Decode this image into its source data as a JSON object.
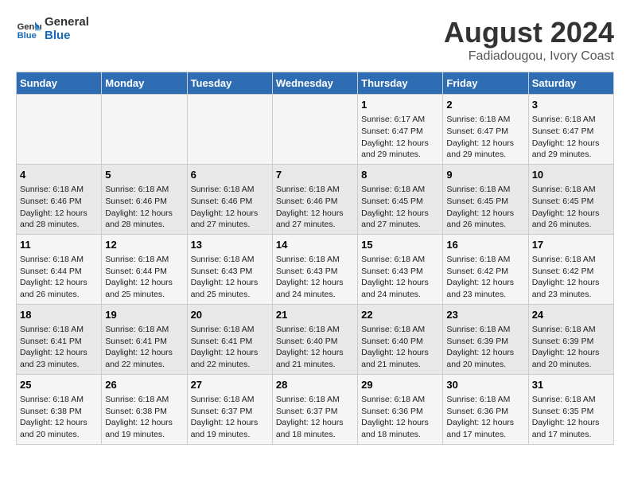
{
  "header": {
    "logo_line1": "General",
    "logo_line2": "Blue",
    "main_title": "August 2024",
    "subtitle": "Fadiadougou, Ivory Coast"
  },
  "days_of_week": [
    "Sunday",
    "Monday",
    "Tuesday",
    "Wednesday",
    "Thursday",
    "Friday",
    "Saturday"
  ],
  "weeks": [
    [
      {
        "day": "",
        "info": ""
      },
      {
        "day": "",
        "info": ""
      },
      {
        "day": "",
        "info": ""
      },
      {
        "day": "",
        "info": ""
      },
      {
        "day": "1",
        "info": "Sunrise: 6:17 AM\nSunset: 6:47 PM\nDaylight: 12 hours and 29 minutes."
      },
      {
        "day": "2",
        "info": "Sunrise: 6:18 AM\nSunset: 6:47 PM\nDaylight: 12 hours and 29 minutes."
      },
      {
        "day": "3",
        "info": "Sunrise: 6:18 AM\nSunset: 6:47 PM\nDaylight: 12 hours and 29 minutes."
      }
    ],
    [
      {
        "day": "4",
        "info": "Sunrise: 6:18 AM\nSunset: 6:46 PM\nDaylight: 12 hours and 28 minutes."
      },
      {
        "day": "5",
        "info": "Sunrise: 6:18 AM\nSunset: 6:46 PM\nDaylight: 12 hours and 28 minutes."
      },
      {
        "day": "6",
        "info": "Sunrise: 6:18 AM\nSunset: 6:46 PM\nDaylight: 12 hours and 27 minutes."
      },
      {
        "day": "7",
        "info": "Sunrise: 6:18 AM\nSunset: 6:46 PM\nDaylight: 12 hours and 27 minutes."
      },
      {
        "day": "8",
        "info": "Sunrise: 6:18 AM\nSunset: 6:45 PM\nDaylight: 12 hours and 27 minutes."
      },
      {
        "day": "9",
        "info": "Sunrise: 6:18 AM\nSunset: 6:45 PM\nDaylight: 12 hours and 26 minutes."
      },
      {
        "day": "10",
        "info": "Sunrise: 6:18 AM\nSunset: 6:45 PM\nDaylight: 12 hours and 26 minutes."
      }
    ],
    [
      {
        "day": "11",
        "info": "Sunrise: 6:18 AM\nSunset: 6:44 PM\nDaylight: 12 hours and 26 minutes."
      },
      {
        "day": "12",
        "info": "Sunrise: 6:18 AM\nSunset: 6:44 PM\nDaylight: 12 hours and 25 minutes."
      },
      {
        "day": "13",
        "info": "Sunrise: 6:18 AM\nSunset: 6:43 PM\nDaylight: 12 hours and 25 minutes."
      },
      {
        "day": "14",
        "info": "Sunrise: 6:18 AM\nSunset: 6:43 PM\nDaylight: 12 hours and 24 minutes."
      },
      {
        "day": "15",
        "info": "Sunrise: 6:18 AM\nSunset: 6:43 PM\nDaylight: 12 hours and 24 minutes."
      },
      {
        "day": "16",
        "info": "Sunrise: 6:18 AM\nSunset: 6:42 PM\nDaylight: 12 hours and 23 minutes."
      },
      {
        "day": "17",
        "info": "Sunrise: 6:18 AM\nSunset: 6:42 PM\nDaylight: 12 hours and 23 minutes."
      }
    ],
    [
      {
        "day": "18",
        "info": "Sunrise: 6:18 AM\nSunset: 6:41 PM\nDaylight: 12 hours and 23 minutes."
      },
      {
        "day": "19",
        "info": "Sunrise: 6:18 AM\nSunset: 6:41 PM\nDaylight: 12 hours and 22 minutes."
      },
      {
        "day": "20",
        "info": "Sunrise: 6:18 AM\nSunset: 6:41 PM\nDaylight: 12 hours and 22 minutes."
      },
      {
        "day": "21",
        "info": "Sunrise: 6:18 AM\nSunset: 6:40 PM\nDaylight: 12 hours and 21 minutes."
      },
      {
        "day": "22",
        "info": "Sunrise: 6:18 AM\nSunset: 6:40 PM\nDaylight: 12 hours and 21 minutes."
      },
      {
        "day": "23",
        "info": "Sunrise: 6:18 AM\nSunset: 6:39 PM\nDaylight: 12 hours and 20 minutes."
      },
      {
        "day": "24",
        "info": "Sunrise: 6:18 AM\nSunset: 6:39 PM\nDaylight: 12 hours and 20 minutes."
      }
    ],
    [
      {
        "day": "25",
        "info": "Sunrise: 6:18 AM\nSunset: 6:38 PM\nDaylight: 12 hours and 20 minutes."
      },
      {
        "day": "26",
        "info": "Sunrise: 6:18 AM\nSunset: 6:38 PM\nDaylight: 12 hours and 19 minutes."
      },
      {
        "day": "27",
        "info": "Sunrise: 6:18 AM\nSunset: 6:37 PM\nDaylight: 12 hours and 19 minutes."
      },
      {
        "day": "28",
        "info": "Sunrise: 6:18 AM\nSunset: 6:37 PM\nDaylight: 12 hours and 18 minutes."
      },
      {
        "day": "29",
        "info": "Sunrise: 6:18 AM\nSunset: 6:36 PM\nDaylight: 12 hours and 18 minutes."
      },
      {
        "day": "30",
        "info": "Sunrise: 6:18 AM\nSunset: 6:36 PM\nDaylight: 12 hours and 17 minutes."
      },
      {
        "day": "31",
        "info": "Sunrise: 6:18 AM\nSunset: 6:35 PM\nDaylight: 12 hours and 17 minutes."
      }
    ]
  ]
}
